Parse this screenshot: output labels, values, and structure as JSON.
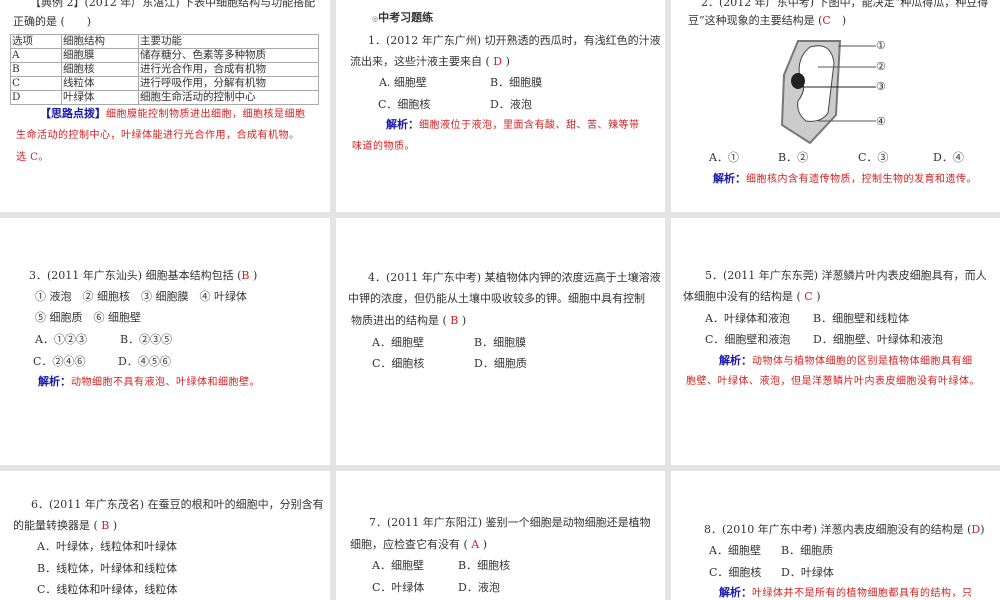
{
  "p1": {
    "q_head": "【典例 2】(2012 年广东湛江) 下表中细胞结构与功能搭配",
    "q_tail": "正确的是 (　　)",
    "table": {
      "headers": [
        "选项",
        "细胞结构",
        "主要功能"
      ],
      "rows": [
        [
          "A",
          "细胞膜",
          "储存糖分、色素等多种物质"
        ],
        [
          "B",
          "细胞核",
          "进行光合作用，合成有机物"
        ],
        [
          "C",
          "线粒体",
          "进行呼吸作用，分解有机物"
        ],
        [
          "D",
          "叶绿体",
          "细胞生命活动的控制中心"
        ]
      ]
    },
    "hint_label": "【思路点拨】",
    "hint": [
      "细胞膜能控制物质进出细胞，细胞核是细胞",
      "生命活动的控制中心，叶绿体能进行光合作用，合成有机物。",
      "选 C。"
    ]
  },
  "p2": {
    "section": "中考习题练",
    "q": [
      "1．(2012 年广东广州) 切开熟透的西瓜时，有浅红色的汁液",
      "流出来，这些汁液主要来自 ("
    ],
    "answer": "D",
    "close": ")",
    "options": [
      "A. 细胞壁",
      "B．细胞膜",
      "C．细胞核",
      "D．液泡"
    ],
    "analysis_label": "解析：",
    "analysis": [
      "细胞液位于液泡，里面含有酸、甜、苦、辣等带",
      "味道的物质。"
    ]
  },
  "p3": {
    "q": [
      "2．(2012 年广东中考) 下图中，能决定“种瓜得瓜，种豆得",
      "豆”这种现象的主要结构是 ("
    ],
    "answer": "C",
    "close": ")",
    "labels": [
      "①",
      "②",
      "③",
      "④"
    ],
    "options": [
      "A．①",
      "B．②",
      "C．③",
      "D．④"
    ],
    "analysis_label": "解析：",
    "analysis": [
      "细胞核内含有遗传物质，控制生物的发育和遗传。"
    ]
  },
  "p4": {
    "q": "3．(2011 年广东汕头) 细胞基本结构包括 (",
    "answer": "B",
    "close": ")",
    "items": [
      "① 液泡　② 细胞核　③ 细胞膜　④ 叶绿体",
      "⑤ 细胞质　⑥ 细胞壁"
    ],
    "options": [
      "A．①②③",
      "B．②③⑤",
      "C．②④⑥",
      "D．④⑤⑥"
    ],
    "analysis_label": "解析：",
    "analysis": [
      "动物细胞不具有液泡、叶绿体和细胞壁。"
    ]
  },
  "p5": {
    "q": [
      "4．(2011 年广东中考) 某植物体内钾的浓度远高于土壤溶液",
      "中钾的浓度，但仍能从土壤中吸收较多的钾。细胞中具有控制",
      "物质进出的结构是 ("
    ],
    "answer": "B",
    "close": ")",
    "options": [
      "A．细胞壁",
      "B．细胞膜",
      "C．细胞核",
      "D．细胞质"
    ]
  },
  "p6": {
    "q": [
      "5．(2011 年广东东莞) 洋葱鳞片叶内表皮细胞具有，而人",
      "体细胞中没有的结构是 ("
    ],
    "answer": "C",
    "close": ")",
    "options": [
      "A．叶绿体和液泡",
      "B．细胞壁和线粒体",
      "C．细胞壁和液泡",
      "D．细胞壁、叶绿体和液泡"
    ],
    "analysis_label": "解析：",
    "analysis": [
      "动物体与植物体细胞的区别是植物体细胞具有细",
      "胞壁、叶绿体、液泡，但是洋葱鳞片叶内表皮细胞没有叶绿体。"
    ]
  },
  "p7": {
    "q": [
      "6．(2011 年广东茂名) 在蚕豆的根和叶的细胞中，分别含有",
      "的能量转换器是 ("
    ],
    "answer": "B",
    "close": ")",
    "options": [
      "A．叶绿体，线粒体和叶绿体",
      "B．线粒体，叶绿体和线粒体",
      "C．线粒体和叶绿体，线粒体"
    ]
  },
  "p8": {
    "q": [
      "7．(2011 年广东阳江) 鉴别一个细胞是动物细胞还是植物",
      "细胞，应检查它有没有 ("
    ],
    "answer": "A",
    "close": ")",
    "options": [
      "A．细胞壁",
      "B．细胞核",
      "C．叶绿体",
      "D．液泡"
    ]
  },
  "p9": {
    "q": "8．(2010 年广东中考) 洋葱内表皮细胞没有的结构是 (",
    "answer": "D",
    "close": ")",
    "options": [
      "A．细胞壁",
      "B．细胞质",
      "C．细胞核",
      "D．叶绿体"
    ],
    "analysis_label": "解析：",
    "analysis": [
      "叶绿体并不是所有的植物细胞都具有的结构，只"
    ]
  }
}
